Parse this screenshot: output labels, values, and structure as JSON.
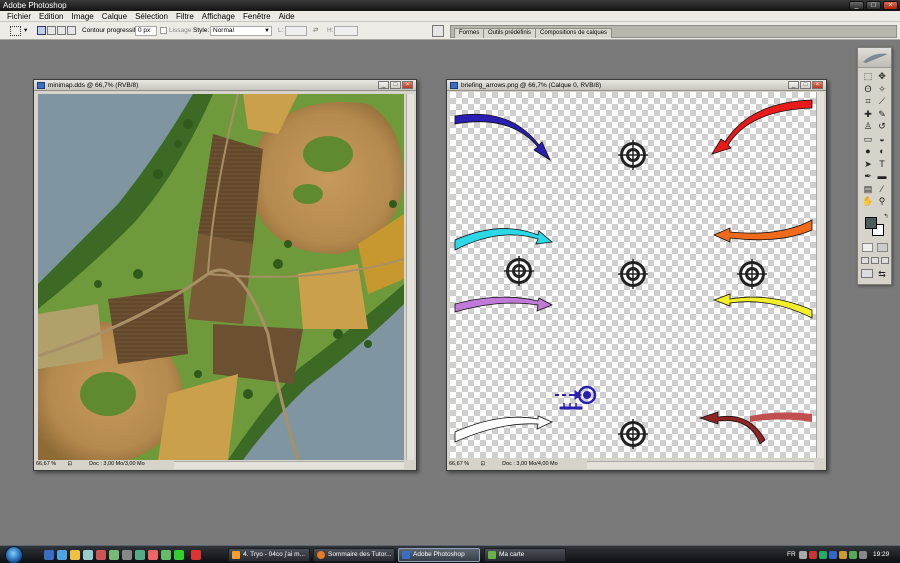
{
  "app": {
    "title": "Adobe Photoshop",
    "window_controls": [
      "_",
      "□",
      "×"
    ]
  },
  "menu": [
    "Fichier",
    "Edition",
    "Image",
    "Calque",
    "Sélection",
    "Filtre",
    "Affichage",
    "Fenêtre",
    "Aide"
  ],
  "options_bar": {
    "feather_label": "Contour progressif :",
    "feather_value": "0 px",
    "antialias_label": "Lissage",
    "style_label": "Style:",
    "style_value": "Normal",
    "width_label": "L:",
    "height_label": "H:"
  },
  "palette_well": {
    "tabs": [
      "Formes",
      "Outils prédéfinis",
      "Compositions de calques"
    ]
  },
  "doc1": {
    "title": "minimap.dds @ 66,7% (RVB/8)",
    "zoom": "66,67 %",
    "doc_info": "Doc : 3,00 Mo/3,00 Mo"
  },
  "doc2": {
    "title": "briefing_arrows.png @ 66,7% (Calque 0, RVB/8)",
    "zoom": "66,67 %",
    "doc_info": "Doc : 3,00 Mo/4,00 Mo"
  },
  "tools_palette": {
    "foreground_color": "#4c5a58",
    "background_color": "#ffffff",
    "tools": [
      "marquee-icon",
      "move-icon",
      "lasso-icon",
      "magic-wand-icon",
      "crop-icon",
      "slice-icon",
      "healing-icon",
      "brush-icon",
      "stamp-icon",
      "history-brush-icon",
      "eraser-icon",
      "bucket-icon",
      "blur-icon",
      "dodge-icon",
      "path-select-icon",
      "type-icon",
      "pen-icon",
      "shape-icon",
      "notes-icon",
      "eyedropper-icon",
      "hand-icon",
      "zoom-icon"
    ],
    "type_tool_label": "T"
  },
  "arrows": {
    "blue": "#2a1fb0",
    "cyan": "#2bd8e6",
    "violet": "#c07ad8",
    "white": "#ffffff",
    "red": "#e81a1a",
    "orange": "#f06a1c",
    "yellow": "#f2ee2a",
    "dark_red": "#8e2424",
    "marker": "#2a1fb0"
  },
  "taskbar": {
    "buttons": [
      {
        "label": "4. Tryo - 04co j'ai m...",
        "active": false
      },
      {
        "label": "Sommaire des Tutor...",
        "active": false
      },
      {
        "label": "Adobe Photoshop",
        "active": true
      },
      {
        "label": "Ma carte",
        "active": false
      }
    ],
    "language": "FR",
    "clock": "19:29"
  }
}
